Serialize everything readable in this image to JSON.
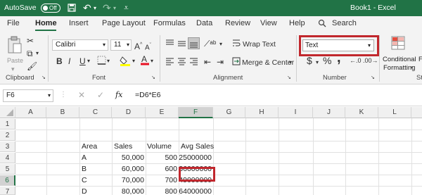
{
  "titlebar": {
    "autosave_label": "AutoSave",
    "toggle_label": "Off",
    "doc_title": "Book1  -  Excel"
  },
  "tabs": [
    "File",
    "Home",
    "Insert",
    "Page Layout",
    "Formulas",
    "Data",
    "Review",
    "View",
    "Help"
  ],
  "search_label": "Search",
  "ribbon": {
    "paste_label": "Paste",
    "font_name": "Calibri",
    "font_size": "11",
    "bold": "B",
    "italic": "I",
    "underline": "U",
    "grow_font": "A",
    "shrink_font": "A",
    "wrap_text": "Wrap Text",
    "merge_center": "Merge & Center",
    "number_format": "Text",
    "currency": "$",
    "percent": "%",
    "comma": ",",
    "conditional_formatting_line1": "Conditional",
    "conditional_formatting_line2": "Formatting",
    "format_clipped": "F",
    "groups": [
      "Clipboard",
      "Font",
      "Alignment",
      "Number",
      "St"
    ]
  },
  "formula_bar": {
    "name_box": "F6",
    "fx": "fx",
    "formula": "=D6*E6"
  },
  "sheet": {
    "columns": [
      "A",
      "B",
      "C",
      "D",
      "E",
      "F",
      "G",
      "H",
      "I",
      "J",
      "K",
      "L"
    ],
    "rows": [
      "1",
      "2",
      "3",
      "4",
      "5",
      "6",
      "7"
    ],
    "selected_cell": "F6",
    "headers": {
      "area": "Area",
      "sales": "Sales",
      "volume": "Volume",
      "avg_sales": "Avg Sales"
    },
    "data": [
      {
        "area": "A",
        "sales": "50,000",
        "volume": "500",
        "avg": "25000000"
      },
      {
        "area": "B",
        "sales": "60,000",
        "volume": "600",
        "avg": "36000000"
      },
      {
        "area": "C",
        "sales": "70,000",
        "volume": "700",
        "avg": "49000000"
      },
      {
        "area": "D",
        "sales": "80,000",
        "volume": "800",
        "avg": "64000000"
      }
    ]
  },
  "colors": {
    "excel_green": "#217346",
    "highlight_red": "#c1272d",
    "font_color_red": "#e81123",
    "fill_yellow": "#ffff00"
  }
}
